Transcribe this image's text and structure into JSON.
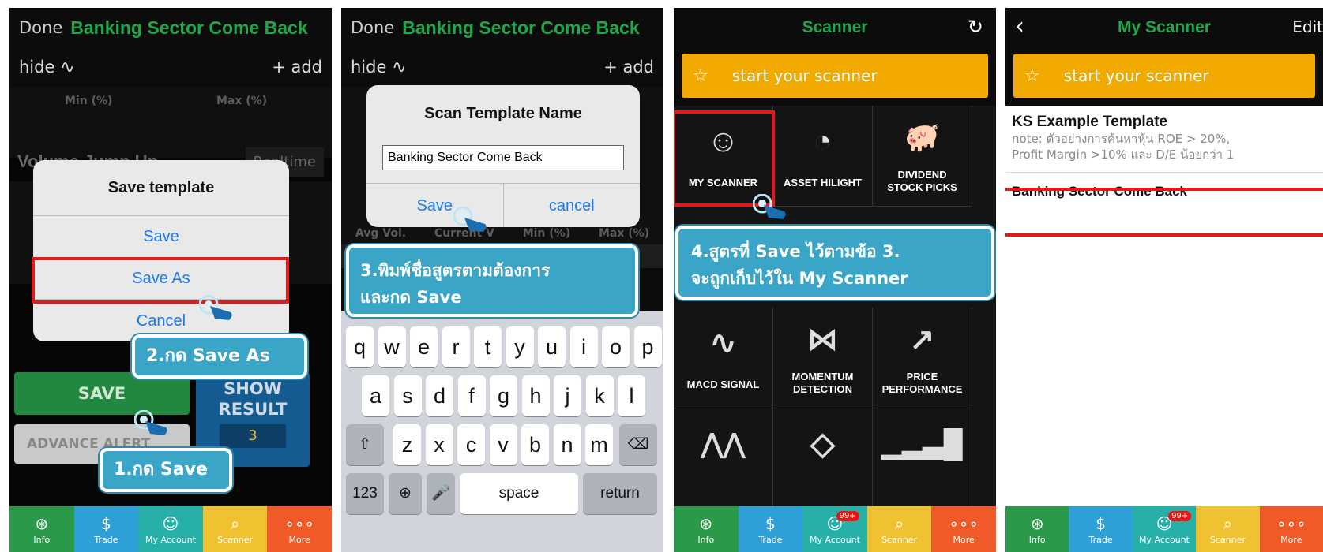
{
  "panel1": {
    "done": "Done",
    "title": "Banking Sector Come Back",
    "hide": "hide",
    "add": "+ add",
    "min_label": "Min (%)",
    "max_label": "Max (%)",
    "volume_jump": "Volume Jump Up",
    "realtime": "Realtime",
    "dialog_title": "Save template",
    "dialog_save": "Save",
    "dialog_save_as": "Save As",
    "dialog_cancel": "Cancel",
    "callout2": "2.กด Save As",
    "save_btn": "SAVE",
    "show_result": "SHOW RESULT",
    "result_count": "3",
    "advance_alert": "ADVANCE ALERT",
    "callout1": "1.กด Save"
  },
  "panel2": {
    "done": "Done",
    "title": "Banking Sector Come Back",
    "hide": "hide",
    "add": "+ add",
    "dialog_title": "Scan Template Name",
    "input_value": "Banking Sector Come Back",
    "save": "Save",
    "cancel": "cancel",
    "col_avg_vol": "Avg Vol.",
    "col_current": "Current V",
    "col_min": "Min (%)",
    "col_max": "Max (%)",
    "callout3_line1": "3.พิมพ์ชื่อสูตรตามต้องการ",
    "callout3_line2": "และกด Save",
    "keys_row1": [
      "q",
      "w",
      "e",
      "r",
      "t",
      "y",
      "u",
      "i",
      "o",
      "p"
    ],
    "keys_row2": [
      "a",
      "s",
      "d",
      "f",
      "g",
      "h",
      "j",
      "k",
      "l"
    ],
    "keys_row3": [
      "z",
      "x",
      "c",
      "v",
      "b",
      "n",
      "m"
    ],
    "key_123": "123",
    "key_space": "space",
    "key_return": "return"
  },
  "panel3": {
    "title": "Scanner",
    "start": "start your scanner",
    "cells": [
      "MY SCANNER",
      "ASSET HILIGHT",
      "DIVIDEND STOCK PICKS",
      "MACD SIGNAL",
      "MOMENTUM DETECTION",
      "PRICE PERFORMANCE"
    ],
    "callout4_line1": "4.สูตรที่ Save ไว้ตามข้อ 3.",
    "callout4_line2": "จะถูกเก็บไว้ใน My Scanner"
  },
  "panel4": {
    "title": "My Scanner",
    "edit": "Edit",
    "start": "start your scanner",
    "template_title": "KS Example Template",
    "template_note_line1": "note: ตัวอย่างการค้นหาหุ้น ROE > 20%,",
    "template_note_line2": "Profit Margin >10% และ D/E น้อยกว่า 1",
    "saved_item": "Banking Sector Come Back"
  },
  "tabbar": {
    "tabs": [
      "Info",
      "Trade",
      "My Account",
      "Scanner",
      "More"
    ],
    "badge": "99+",
    "colors": [
      "#2a9a4a",
      "#2f9fd8",
      "#27b0a8",
      "#f0c232",
      "#f05a28"
    ]
  },
  "colors": {
    "green": "#1fa84a",
    "orange": "#f2a900",
    "red_highlight": "#e21a1a",
    "callout": "#3aa5c6",
    "ios_blue": "#1b7bf2"
  }
}
